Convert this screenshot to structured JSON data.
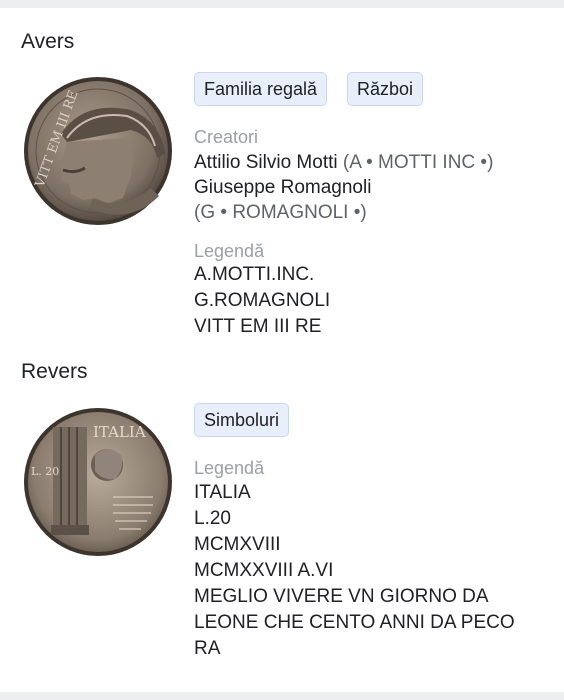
{
  "obverse": {
    "title": "Avers",
    "chips": [
      "Familia regală",
      "Război"
    ],
    "creators_label": "Creatori",
    "creators": [
      {
        "name": "Attilio Silvio Motti",
        "mark": "(A • MOTTI INC •)"
      },
      {
        "name": "Giuseppe Romagnoli",
        "mark": "(G • ROMAGNOLI •)"
      }
    ],
    "legend_label": "Legendă",
    "legend": [
      "A.MOTTI.INC.",
      "G.ROMAGNOLI",
      "VITT EM III RE"
    ],
    "coin_inscription": "VITT EM III RE"
  },
  "reverse": {
    "title": "Revers",
    "chips": [
      "Simboluri"
    ],
    "legend_label": "Legendă",
    "legend": [
      "ITALIA",
      "L.20",
      "MCMXVIII",
      "MCMXXVIII A.VI",
      "MEGLIO VIVERE VN GIORNO DA",
      "LEONE CHE CENTO ANNI DA PECO",
      "RA"
    ],
    "coin_inscription": "ITALIA",
    "coin_value": "L. 20"
  }
}
